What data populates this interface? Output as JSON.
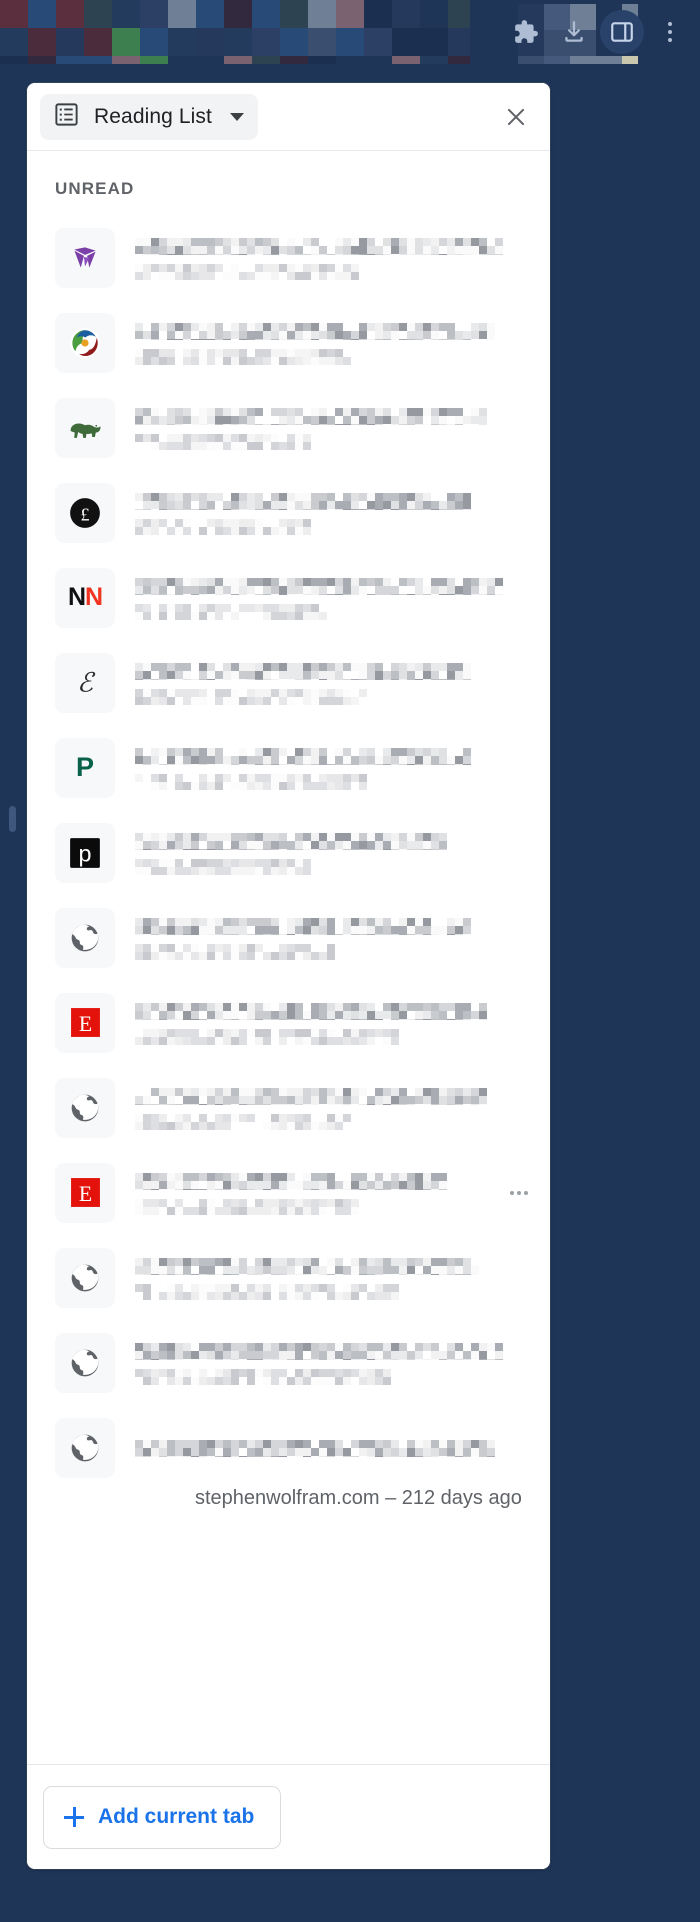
{
  "browser": {
    "background_color": "#1e3557",
    "toolbar_icons": [
      {
        "name": "extensions-icon",
        "label": "Extensions"
      },
      {
        "name": "downloads-icon",
        "label": "Downloads"
      },
      {
        "name": "side-panel-icon",
        "label": "Side panel",
        "active": true
      },
      {
        "name": "chrome-menu-icon",
        "label": "Customize and control Google Chrome"
      }
    ]
  },
  "panel": {
    "selector": {
      "icon": "reading-list-icon",
      "label": "Reading List",
      "caret": "chevron-down-icon"
    },
    "close_label": "Close",
    "section_title": "UNREAD",
    "footer": {
      "add_label": "Add current tab",
      "plus_icon": "plus-icon",
      "accent_color": "#1a73e8"
    }
  },
  "items": [
    {
      "favicon": "vector-purple-icon",
      "title_redacted": true,
      "source_redacted": true
    },
    {
      "favicon": "swirl-color-icon",
      "title_redacted": true,
      "source_redacted": true
    },
    {
      "favicon": "green-bear-icon",
      "title_redacted": true,
      "source_redacted": true
    },
    {
      "favicon": "pound-sterling-icon",
      "title_redacted": true,
      "source_redacted": true
    },
    {
      "favicon": "nn-letters-icon",
      "title_redacted": true,
      "source_redacted": true
    },
    {
      "favicon": "script-e-icon",
      "title_redacted": true,
      "source_redacted": true
    },
    {
      "favicon": "green-p-icon",
      "title_redacted": true,
      "source_redacted": true
    },
    {
      "favicon": "black-p-icon",
      "title_redacted": true,
      "source_redacted": true
    },
    {
      "favicon": "globe-icon",
      "title_redacted": true,
      "source_redacted": true
    },
    {
      "favicon": "red-e-icon",
      "title_redacted": true,
      "source_redacted": true
    },
    {
      "favicon": "globe-icon",
      "title_redacted": true,
      "source_redacted": true
    },
    {
      "favicon": "red-e-icon",
      "title_redacted": true,
      "source_redacted": true,
      "more_menu": true
    },
    {
      "favicon": "globe-icon",
      "title_redacted": true,
      "source_redacted": true
    },
    {
      "favicon": "globe-icon",
      "title_redacted": true,
      "source_redacted": true
    },
    {
      "favicon": "globe-icon",
      "title_redacted": true,
      "source": "stephenwolfram.com – 212 days ago"
    }
  ]
}
